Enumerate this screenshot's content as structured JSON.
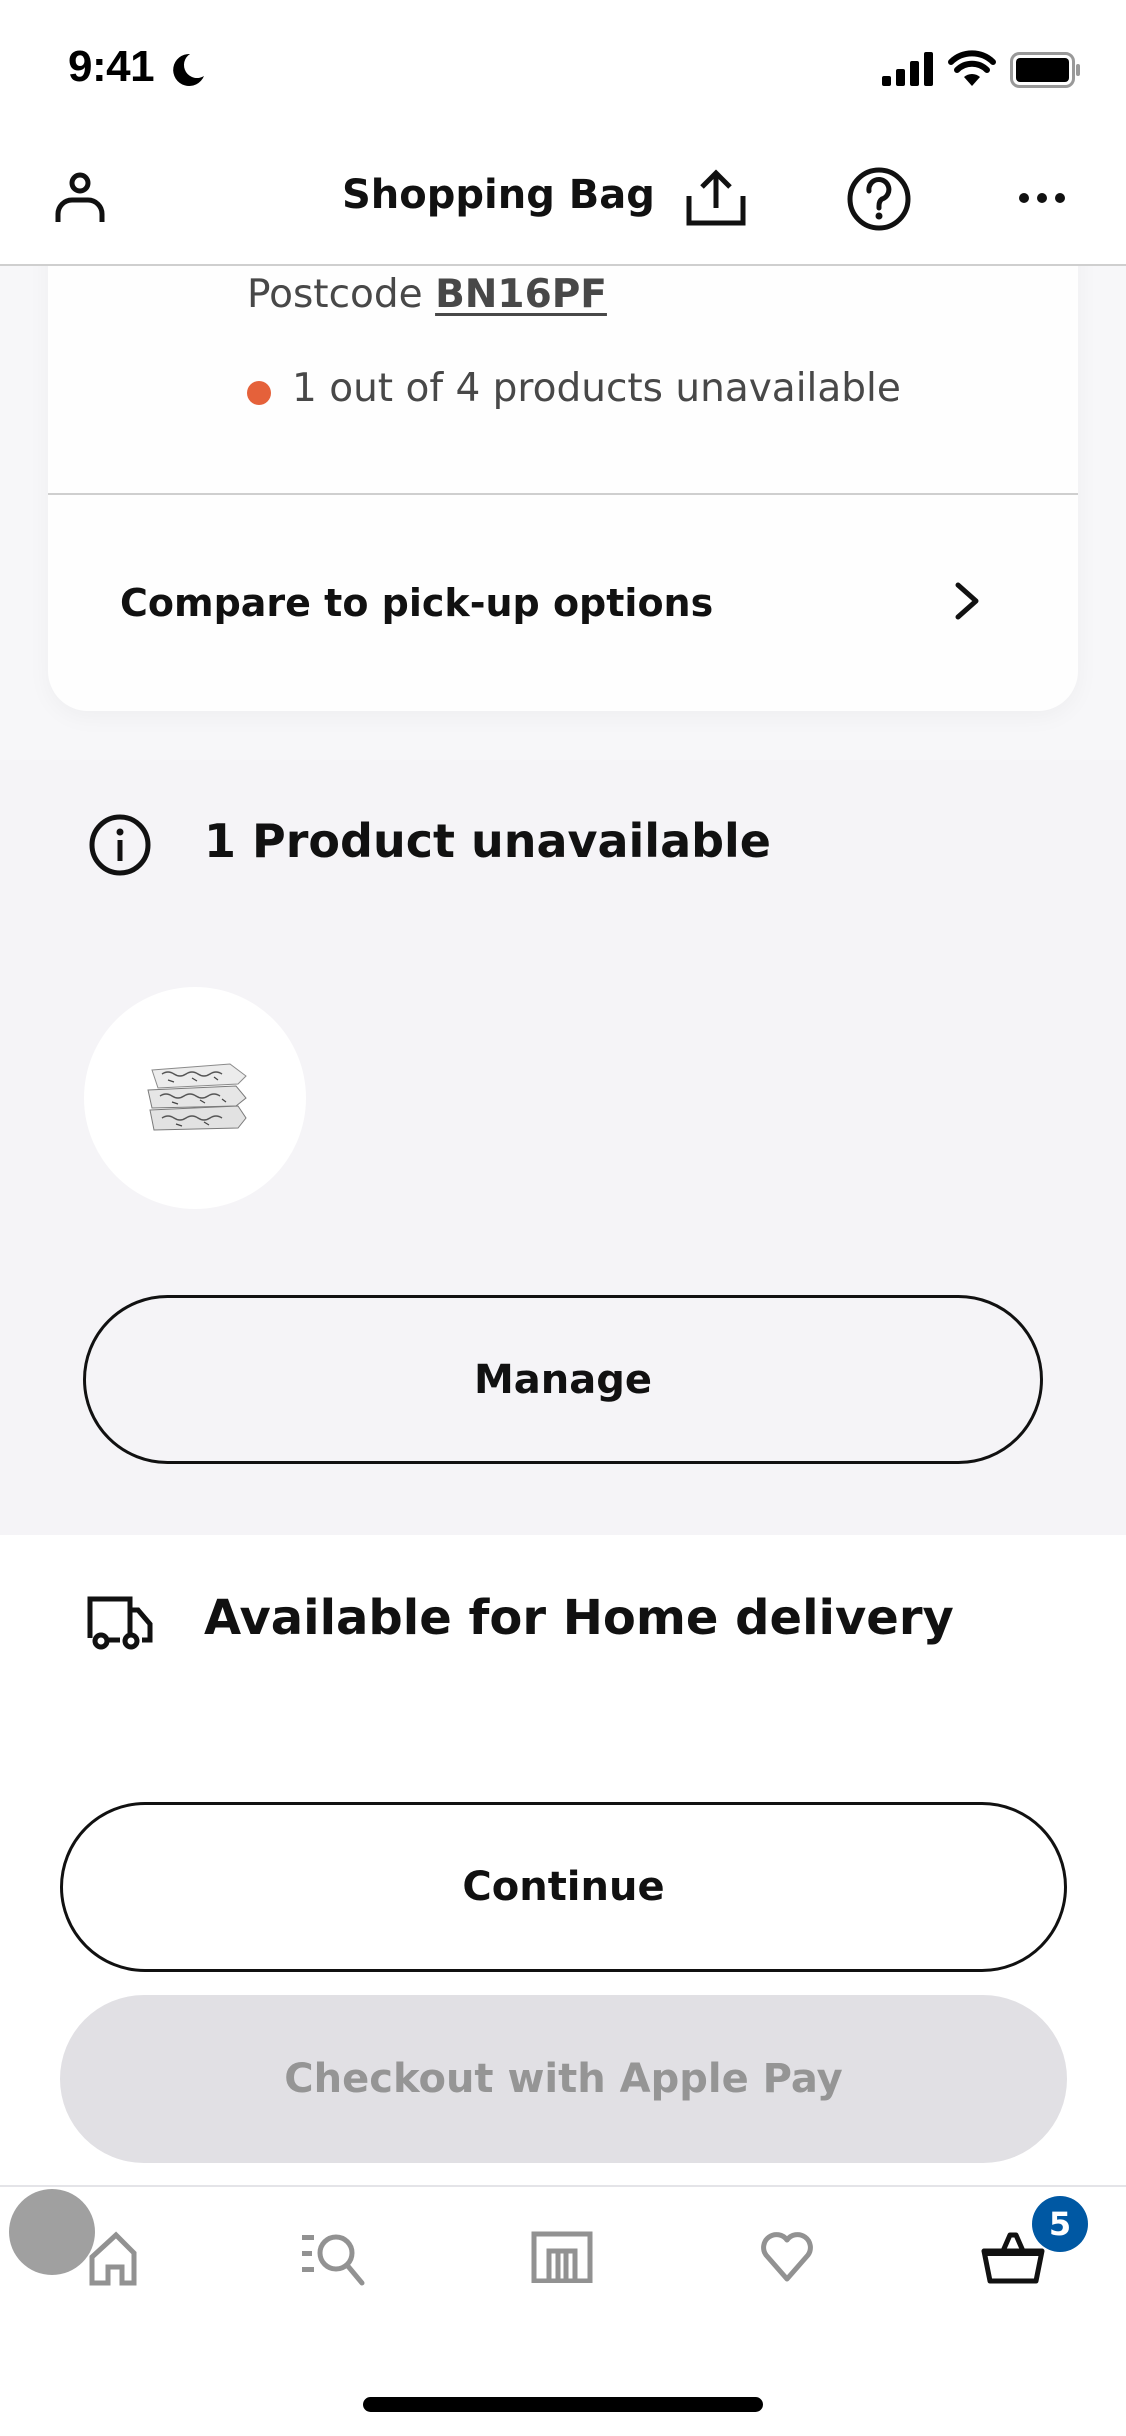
{
  "status_bar": {
    "time": "9:41",
    "focus_icon": "moon-icon",
    "signal_icon": "cellular-signal-icon",
    "wifi_icon": "wifi-icon",
    "battery_icon": "battery-icon"
  },
  "header": {
    "title": "Shopping Bag",
    "left_icon": "profile-icon",
    "right_icons": [
      "share-icon",
      "help-icon",
      "more-icon"
    ]
  },
  "delivery_card": {
    "postcode_label": "Postcode",
    "postcode_value": "BN16PF",
    "availability_text": "1 out of 4 products unavailable",
    "availability_color": "#e5613a",
    "compare_label": "Compare to pick-up options",
    "compare_icon": "chevron-right-icon"
  },
  "unavailable_section": {
    "icon": "info-icon",
    "heading": "1 Product unavailable",
    "products": [
      {
        "image": "bedding-set-thumbnail"
      }
    ],
    "manage_label": "Manage"
  },
  "home_delivery": {
    "icon": "truck-icon",
    "heading": "Available for Home delivery"
  },
  "actions": {
    "continue_label": "Continue",
    "apple_pay_label": "Checkout with Apple Pay",
    "apple_pay_enabled": false
  },
  "tab_bar": {
    "items": [
      {
        "id": "home",
        "icon": "home-icon",
        "active": false
      },
      {
        "id": "search",
        "icon": "search-icon",
        "active": false
      },
      {
        "id": "stores",
        "icon": "store-icon",
        "active": false
      },
      {
        "id": "favourites",
        "icon": "heart-icon",
        "active": false
      },
      {
        "id": "bag",
        "icon": "basket-icon",
        "active": true
      }
    ],
    "bag_badge_count": "5",
    "badge_color": "#0058a3",
    "inactive_color": "#929292",
    "active_color": "#111111"
  }
}
